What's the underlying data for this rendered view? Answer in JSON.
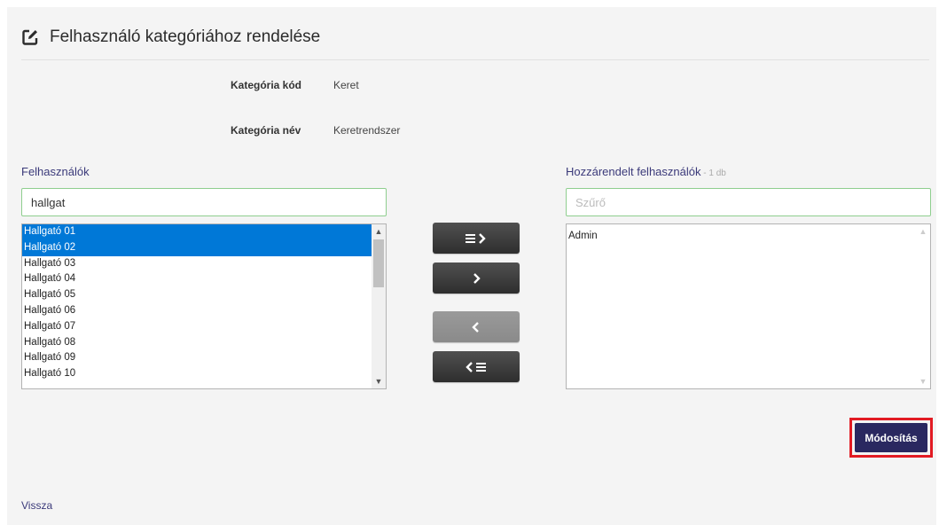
{
  "page": {
    "title": "Felhasználó kategóriához rendelése"
  },
  "info": {
    "code_label": "Kategória kód",
    "code_value": "Keret",
    "name_label": "Kategória név",
    "name_value": "Keretrendszer"
  },
  "left": {
    "heading": "Felhasználók",
    "search_value": "hallgat",
    "items": [
      {
        "label": "Hallgató 01",
        "selected": true
      },
      {
        "label": "Hallgató 02",
        "selected": true
      },
      {
        "label": "Hallgató 03",
        "selected": false
      },
      {
        "label": "Hallgató 04",
        "selected": false
      },
      {
        "label": "Hallgató 05",
        "selected": false
      },
      {
        "label": "Hallgató 06",
        "selected": false
      },
      {
        "label": "Hallgató 07",
        "selected": false
      },
      {
        "label": "Hallgató 08",
        "selected": false
      },
      {
        "label": "Hallgató 09",
        "selected": false
      },
      {
        "label": "Hallgató 10",
        "selected": false
      }
    ]
  },
  "right": {
    "heading": "Hozzárendelt felhasználók",
    "count": " - 1 db",
    "filter_placeholder": "Szűrő",
    "items": [
      {
        "label": "Admin",
        "selected": false
      }
    ]
  },
  "buttons": {
    "add_all_icon": "list-arrow-right-icon",
    "add_selected_icon": "chevron-right-icon",
    "remove_selected_icon": "chevron-left-icon",
    "remove_all_icon": "arrow-left-list-icon",
    "submit_label": "Módosítás"
  },
  "footer": {
    "back_label": "Vissza"
  },
  "colors": {
    "accent": "#3b3a7a",
    "submit_bg": "#2a2860",
    "highlight": "#e21b23",
    "selection": "#0078d7"
  }
}
